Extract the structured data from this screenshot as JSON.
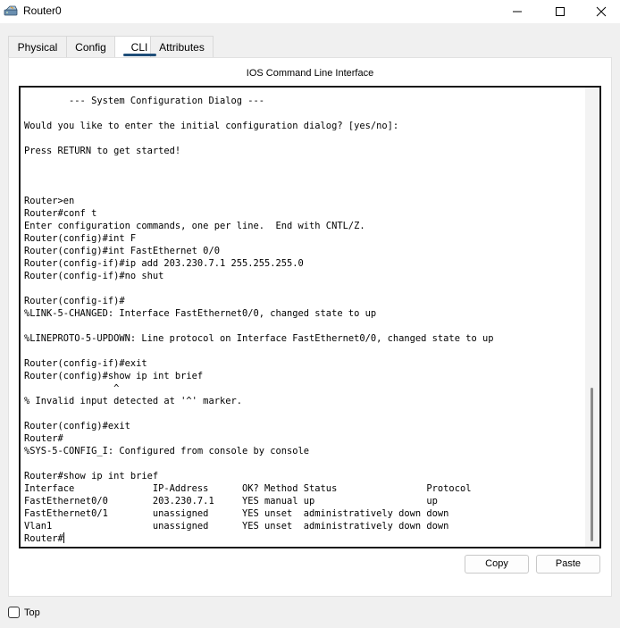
{
  "window": {
    "title": "Router0",
    "icon": "router-icon",
    "controls": [
      "minimize-icon",
      "maximize-icon",
      "close-icon"
    ]
  },
  "tabs": [
    {
      "label": "Physical",
      "active": false
    },
    {
      "label": "Config",
      "active": false
    },
    {
      "label": "CLI",
      "active": true
    },
    {
      "label": "Attributes",
      "active": false
    }
  ],
  "panel_title": "IOS Command Line Interface",
  "terminal": {
    "lines": [
      "        --- System Configuration Dialog ---",
      "",
      "Would you like to enter the initial configuration dialog? [yes/no]:",
      "",
      "Press RETURN to get started!",
      "",
      "",
      "",
      "Router>en",
      "Router#conf t",
      "Enter configuration commands, one per line.  End with CNTL/Z.",
      "Router(config)#int F",
      "Router(config)#int FastEthernet 0/0",
      "Router(config-if)#ip add 203.230.7.1 255.255.255.0",
      "Router(config-if)#no shut",
      "",
      "Router(config-if)#",
      "%LINK-5-CHANGED: Interface FastEthernet0/0, changed state to up",
      "",
      "%LINEPROTO-5-UPDOWN: Line protocol on Interface FastEthernet0/0, changed state to up",
      "",
      "Router(config-if)#exit",
      "Router(config)#show ip int brief",
      "                ^",
      "% Invalid input detected at '^' marker.",
      "",
      "Router(config)#exit",
      "Router#",
      "%SYS-5-CONFIG_I: Configured from console by console",
      "",
      "Router#show ip int brief",
      "Interface              IP-Address      OK? Method Status                Protocol",
      "FastEthernet0/0        203.230.7.1     YES manual up                    up",
      "FastEthernet0/1        unassigned      YES unset  administratively down down",
      "Vlan1                  unassigned      YES unset  administratively down down",
      "Router#"
    ]
  },
  "buttons": {
    "copy": "Copy",
    "paste": "Paste"
  },
  "footer": {
    "top_label": "Top",
    "top_checked": false
  }
}
